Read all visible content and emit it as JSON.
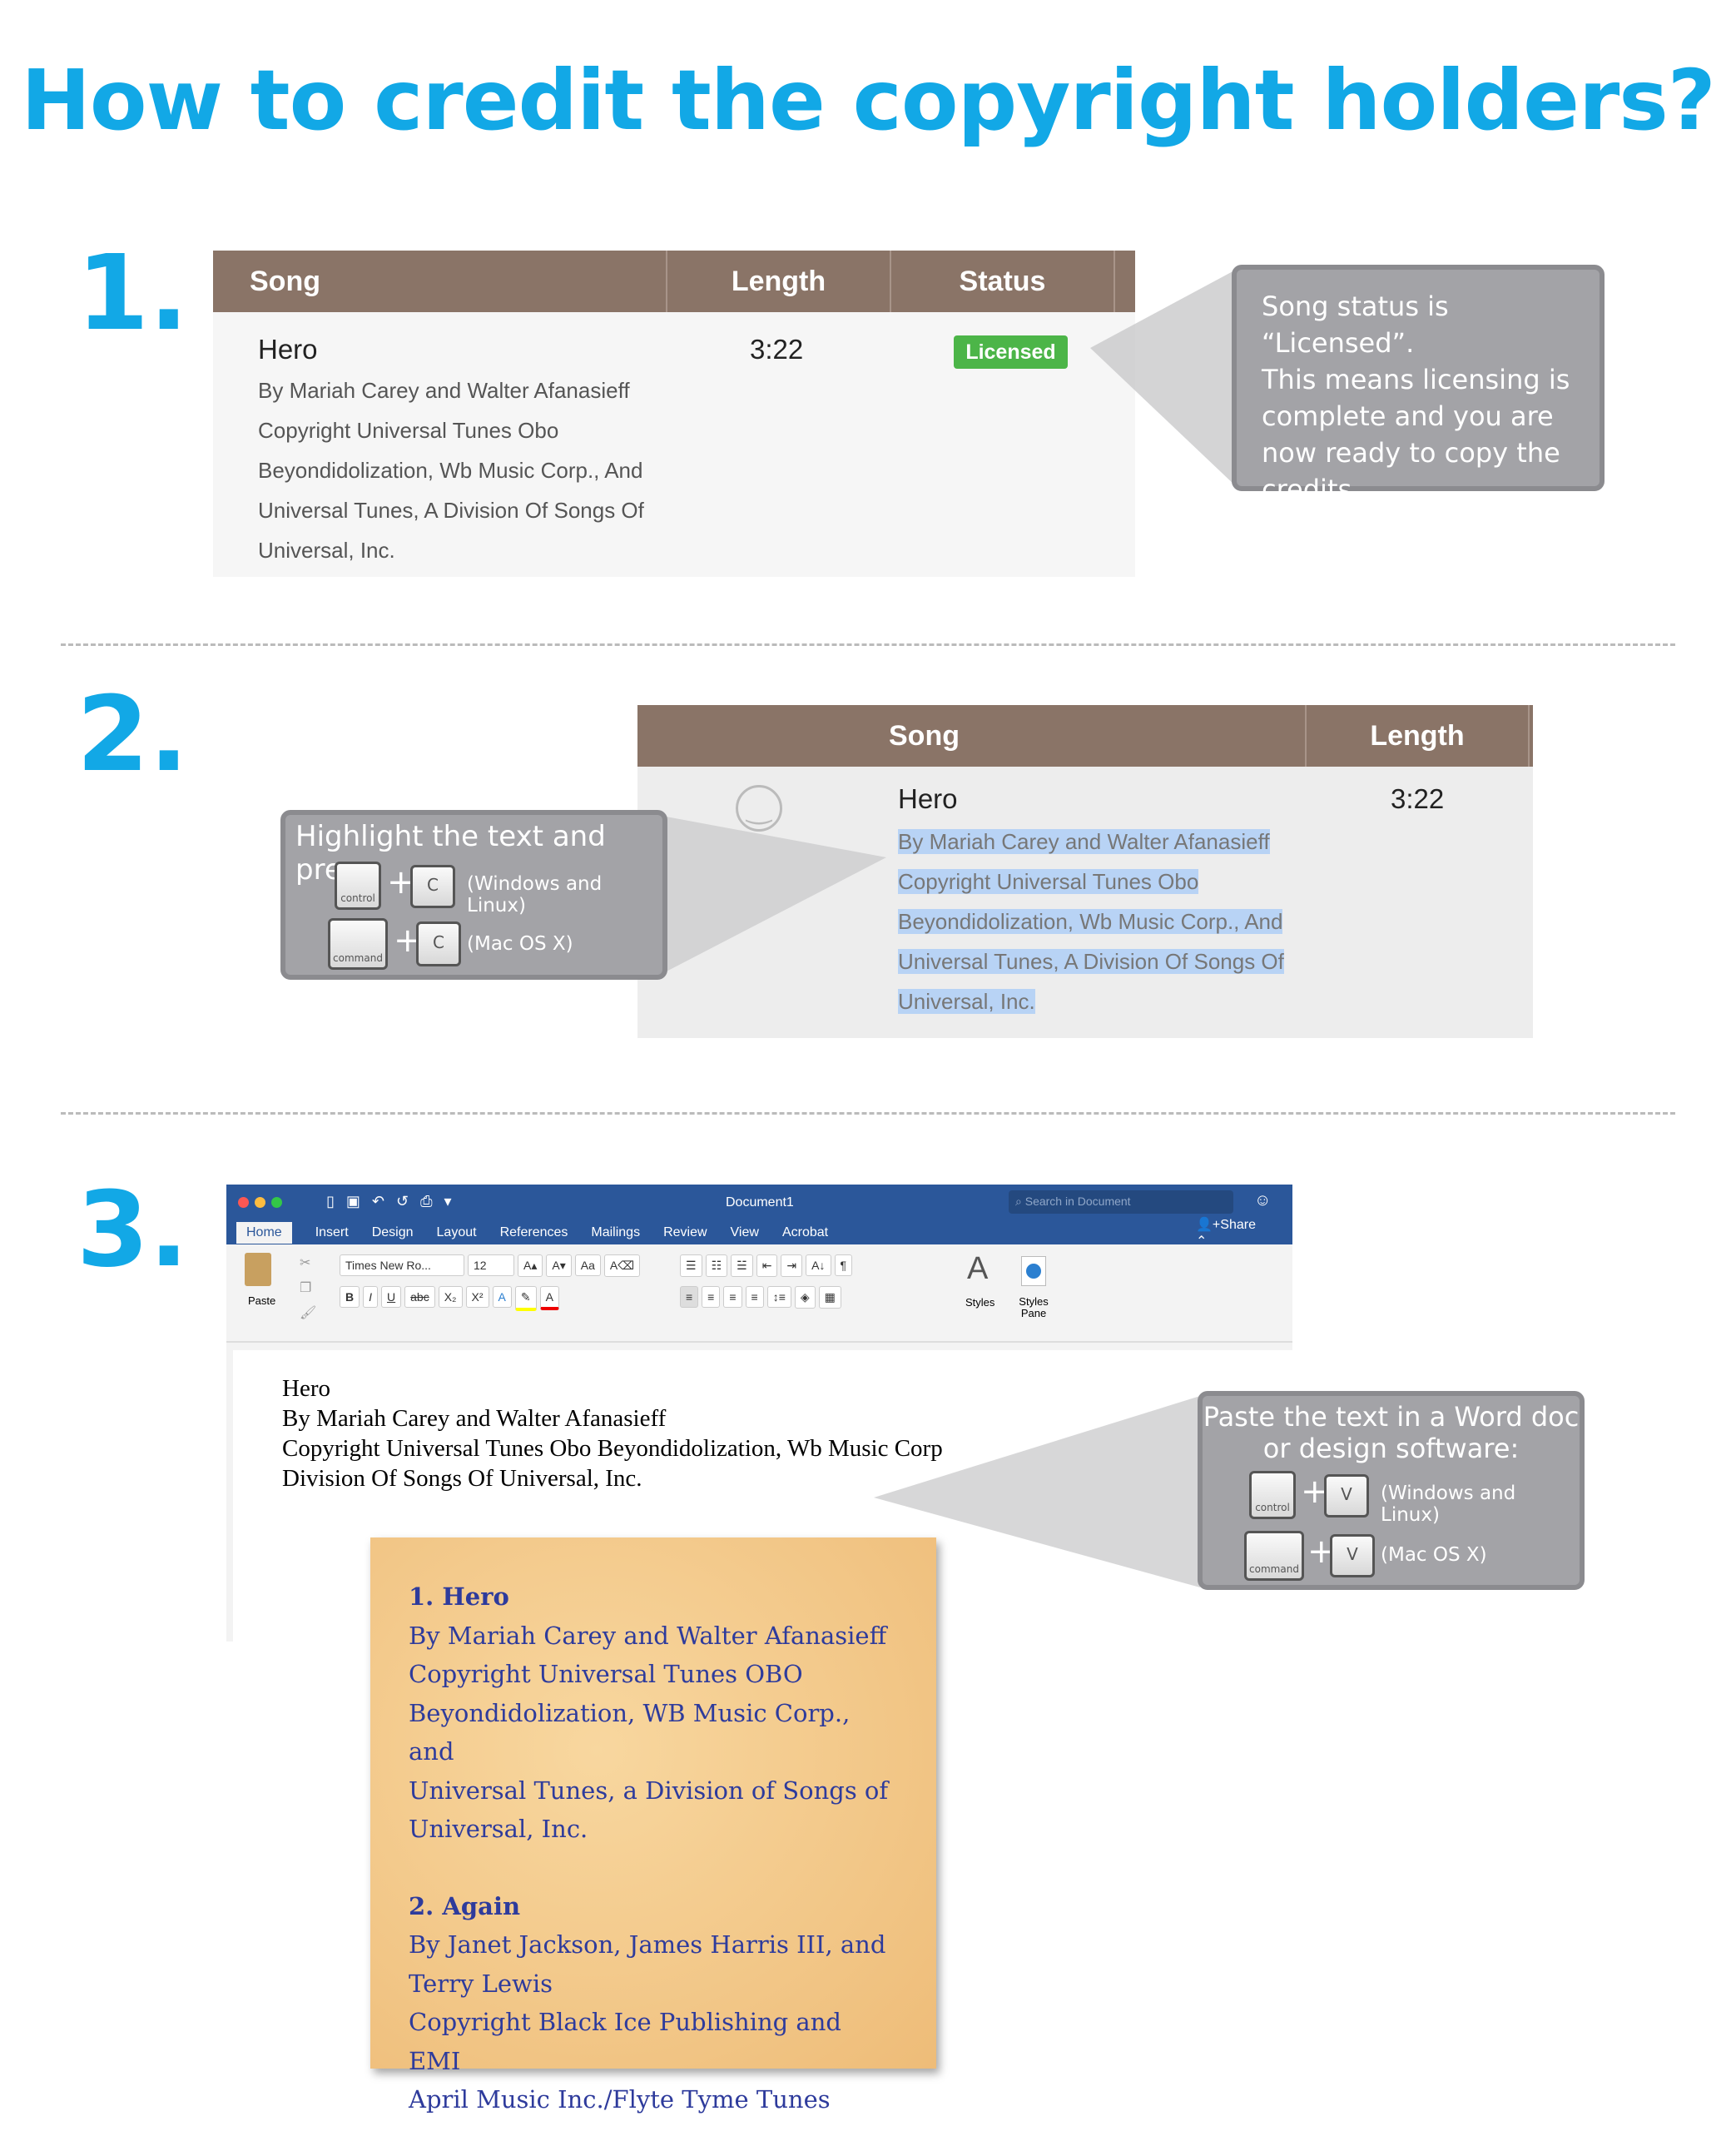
{
  "title": "How to credit the copyright holders?",
  "colors": {
    "accent": "#12a8e6",
    "table_header": "#8a7467",
    "licensed": "#4cb548",
    "callout": "#a3a3a7",
    "word_blue": "#2b579a",
    "note": "#f4c98a"
  },
  "step1": {
    "number": "1.",
    "headers": [
      "Song",
      "Length",
      "Status"
    ],
    "song": "Hero",
    "length": "3:22",
    "status": "Licensed",
    "credit_lines": [
      "By Mariah Carey and Walter Afanasieff",
      "Copyright Universal Tunes Obo",
      "Beyondidolization, Wb Music Corp., And",
      "Universal Tunes, A Division Of Songs Of",
      "Universal, Inc."
    ],
    "callout_lines": [
      "Song status is “Licensed”.",
      "This means licensing is",
      "complete and you are",
      "now ready to copy the",
      "credits."
    ]
  },
  "step2": {
    "number": "2.",
    "headers": [
      "Song",
      "Length"
    ],
    "song": "Hero",
    "length": "3:22",
    "smiley_icon": "smiley-icon",
    "credit_lines": [
      "By Mariah Carey and Walter Afanasieff",
      "Copyright Universal Tunes Obo",
      "Beyondidolization, Wb Music Corp., And",
      "Universal Tunes, A Division Of Songs Of",
      "Universal, Inc."
    ],
    "callout_title": "Highlight the text and press:",
    "key_control": "control",
    "key_command": "command",
    "key_letter": "C",
    "plus": "+",
    "windows": "(Windows and Linux)",
    "mac": "(Mac OS X)"
  },
  "step3": {
    "number": "3.",
    "word": {
      "doc_title": "Document1",
      "search_placeholder": "Search in Document",
      "tabs": [
        "Home",
        "Insert",
        "Design",
        "Layout",
        "References",
        "Mailings",
        "Review",
        "View",
        "Acrobat"
      ],
      "share": "Share",
      "font": "Times New Ro...",
      "size": "12",
      "paste": "Paste",
      "styles": "Styles",
      "styles_pane": "Styles Pane",
      "doc_lines": [
        "Hero",
        "By Mariah Carey and Walter Afanasieff",
        "Copyright Universal Tunes Obo Beyondidolization, Wb Music Corp",
        "Division Of Songs Of Universal, Inc."
      ]
    },
    "callout_lines": [
      "Paste the text in a Word doc",
      "or design software:"
    ],
    "key_control": "control",
    "key_command": "command",
    "key_letter": "V",
    "plus": "+",
    "windows": "(Windows and Linux)",
    "mac": "(Mac OS X)",
    "note": {
      "entries": [
        {
          "title": "1. Hero",
          "lines": [
            "By Mariah Carey and Walter Afanasieff",
            "Copyright Universal Tunes OBO",
            "Beyondidolization, WB Music Corp., and",
            "Universal Tunes, a Division of Songs of",
            "Universal, Inc."
          ]
        },
        {
          "title": "2. Again",
          "lines": [
            "By Janet Jackson, James Harris III, and",
            "Terry Lewis",
            "Copyright Black Ice Publishing and EMI",
            "April Music Inc./Flyte Tyme Tunes"
          ]
        }
      ]
    }
  }
}
